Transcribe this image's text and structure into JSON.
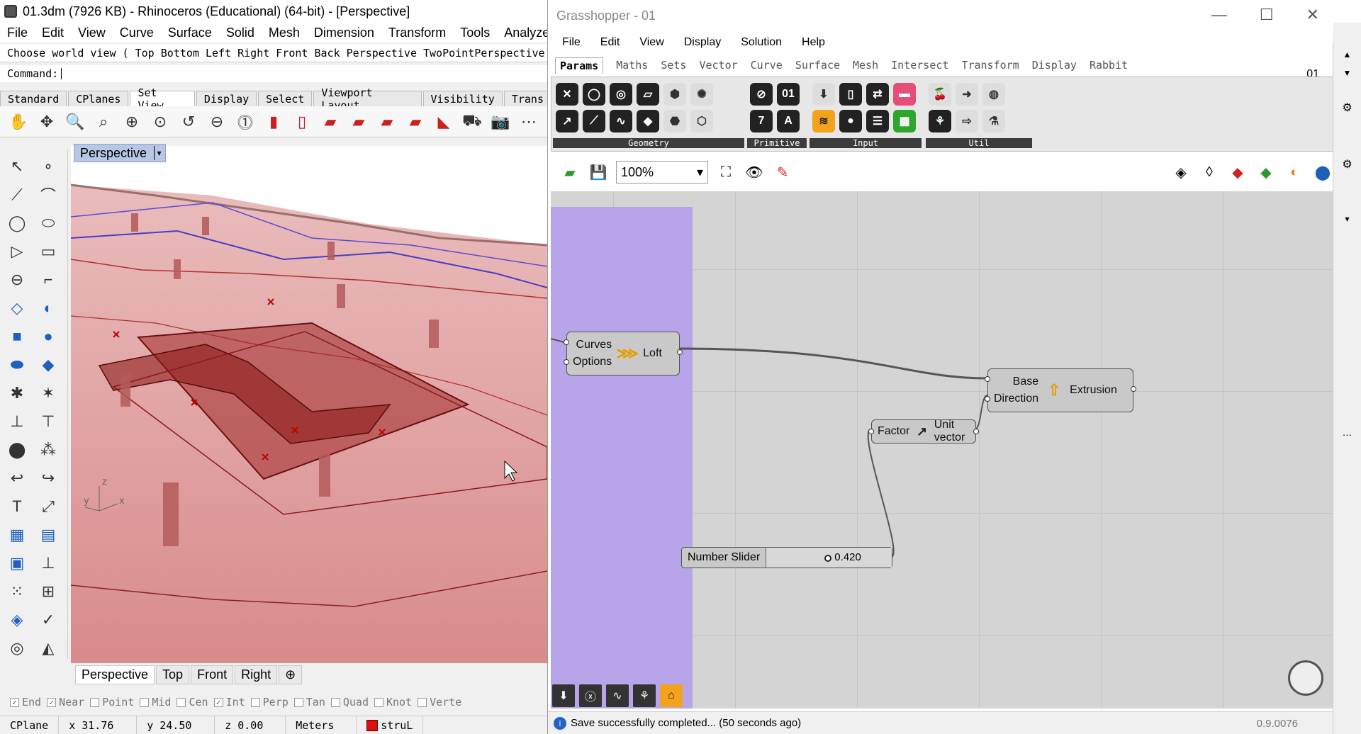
{
  "rhino": {
    "title": "01.3dm (7926 KB) - Rhinoceros (Educational) (64-bit) - [Perspective]",
    "menu": [
      "File",
      "Edit",
      "View",
      "Curve",
      "Surface",
      "Solid",
      "Mesh",
      "Dimension",
      "Transform",
      "Tools",
      "Analyze"
    ],
    "command_history": "Choose world view ( Top  Bottom  Left  Right  Front  Back  Perspective  TwoPointPerspective",
    "command_prompt": "Command:",
    "toolbar_tabs": [
      "Standard",
      "CPlanes",
      "Set View",
      "Display",
      "Select",
      "Viewport Layout",
      "Visibility",
      "Trans"
    ],
    "active_toolbar_tab": "Set View",
    "viewport_label": "Perspective",
    "viewport_tabs": [
      "Perspective",
      "Top",
      "Front",
      "Right"
    ],
    "osnaps": [
      {
        "label": "End",
        "checked": true
      },
      {
        "label": "Near",
        "checked": true
      },
      {
        "label": "Point",
        "checked": false
      },
      {
        "label": "Mid",
        "checked": false
      },
      {
        "label": "Cen",
        "checked": false
      },
      {
        "label": "Int",
        "checked": true
      },
      {
        "label": "Perp",
        "checked": false
      },
      {
        "label": "Tan",
        "checked": false
      },
      {
        "label": "Quad",
        "checked": false
      },
      {
        "label": "Knot",
        "checked": false
      },
      {
        "label": "Verte",
        "checked": false
      }
    ],
    "status": {
      "cplane": "CPlane",
      "x": "x 31.76",
      "y": "y 24.50",
      "z": "z 0.00",
      "units": "Meters",
      "layer": "struL",
      "layer_color": "#e01010"
    },
    "axis": {
      "z": "z",
      "y": "y",
      "x": "x"
    }
  },
  "gh": {
    "title": "Grasshopper - 01",
    "menu": [
      "File",
      "Edit",
      "View",
      "Display",
      "Solution",
      "Help"
    ],
    "doc_name": "01",
    "tabs": [
      "Params",
      "Maths",
      "Sets",
      "Vector",
      "Curve",
      "Surface",
      "Mesh",
      "Intersect",
      "Transform",
      "Display",
      "Rabbit"
    ],
    "active_tab": "Params",
    "ribbon_groups": {
      "geometry": "Geometry",
      "primitive": "Primitive",
      "input": "Input",
      "util": "Util"
    },
    "zoom": "100%",
    "canvas": {
      "loft": {
        "inputs": [
          "Curves",
          "Options"
        ],
        "output": "Loft"
      },
      "extrusion": {
        "inputs": [
          "Base",
          "Direction"
        ],
        "output": "Extrusion"
      },
      "unit_vector": {
        "input": "Factor",
        "output": "Unit vector"
      },
      "slider": {
        "name": "Number Slider",
        "value": "0.420",
        "fraction": 0.42
      }
    },
    "status": "Save successfully completed... (50 seconds ago)",
    "version": "0.9.0076",
    "colors": {
      "group": "#b8a4e8",
      "canvas": "#d4d4d4",
      "component": "#c9c9c9",
      "accent": "#e59d00"
    }
  }
}
